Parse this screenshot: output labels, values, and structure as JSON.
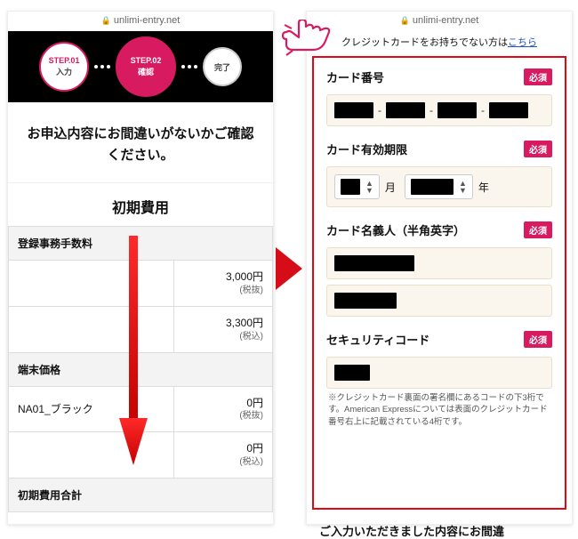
{
  "domain_url": "unlimi-entry.net",
  "left": {
    "steps": [
      {
        "code": "STEP.01",
        "label": "入力"
      },
      {
        "code": "STEP.02",
        "label": "確認"
      },
      {
        "code": "",
        "label": "完了"
      }
    ],
    "confirm_message": "お申込内容にお間違いがないかご確認ください。",
    "section_title": "初期費用",
    "rows": [
      {
        "header": "登録事務手数料",
        "lines": [
          {
            "amount": "3,000円",
            "note": "(税抜)"
          },
          {
            "amount": "3,300円",
            "note": "(税込)"
          }
        ]
      },
      {
        "header": "端末価格",
        "lines": []
      },
      {
        "header": "NA01_ブラック",
        "lines": [
          {
            "amount": "0円",
            "note": "(税抜)"
          },
          {
            "amount": "0円",
            "note": "(税込)"
          }
        ]
      }
    ],
    "total_label": "初期費用合計"
  },
  "right": {
    "cc_note_prefix": "クレジットカードをお持ちでない方は",
    "cc_note_link": "こちら",
    "required_badge": "必須",
    "fields": {
      "card_number_label": "カード番号",
      "expiry_label": "カード有効期限",
      "expiry_month_unit": "月",
      "expiry_year_unit": "年",
      "holder_label": "カード名義人（半角英字）",
      "cvc_label": "セキュリティコード",
      "cvc_help": "※クレジットカード裏面の署名欄にあるコードの下3桁です。American Expressについては表面のクレジットカード番号右上に記載されている4桁です。"
    },
    "bottom_cut_text": "ご入力いただきました内容にお間違"
  }
}
